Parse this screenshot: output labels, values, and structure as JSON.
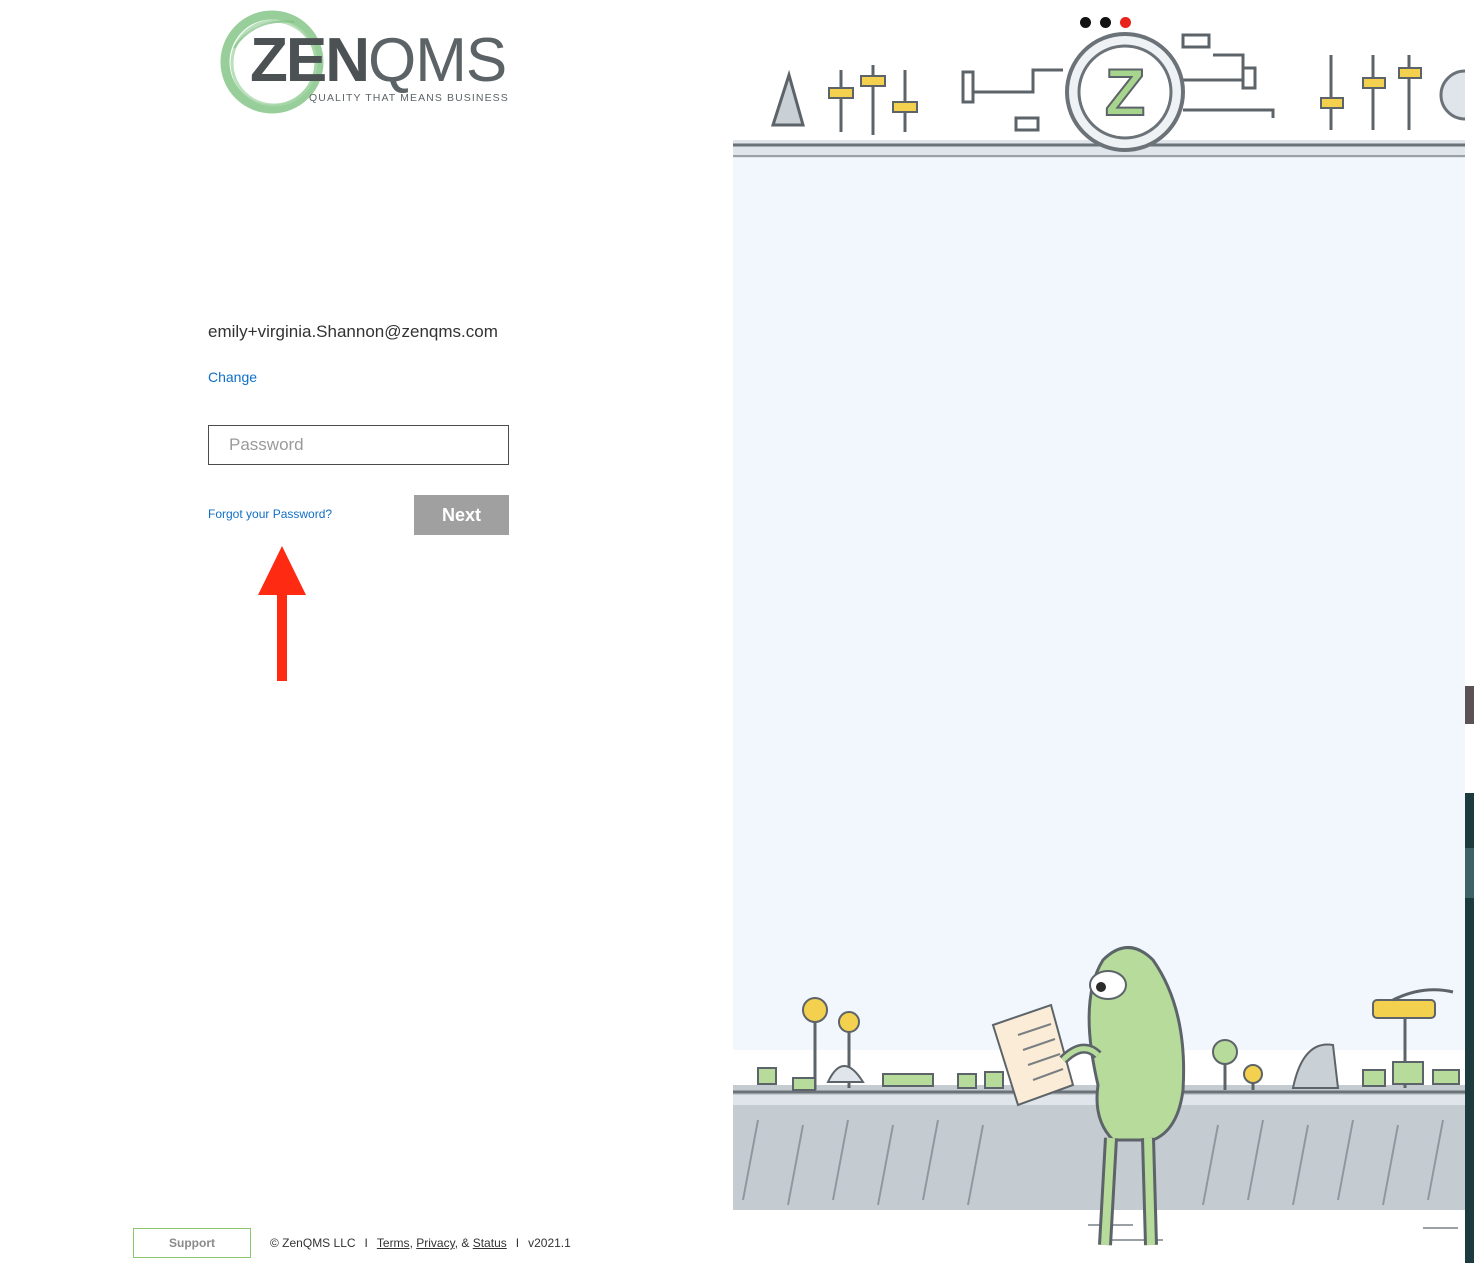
{
  "brand": {
    "logo_word_bold": "ZEN",
    "logo_word_light": "QMS",
    "tagline": "QUALITY THAT MEANS BUSINESS",
    "ring_color": "#8cc98f",
    "text_color": "#4c5254"
  },
  "login": {
    "email": "emily+virginia.Shannon@zenqms.com",
    "change_label": "Change",
    "password_placeholder": "Password",
    "forgot_label": "Forgot your Password?",
    "next_label": "Next",
    "link_color": "#0f6fc7",
    "next_bg": "#a0a0a0"
  },
  "annotation": {
    "arrow_color": "#ff2a12",
    "arrow_icon": "up-arrow-icon"
  },
  "footer": {
    "support_label": "Support",
    "copyright": "© ZenQMS LLC",
    "divider": "I",
    "terms_label": "Terms",
    "privacy_label": "Privacy",
    "and_text": "&",
    "status_label": "Status",
    "version": "v2021.1"
  },
  "carousel": {
    "dots": [
      "inactive",
      "inactive",
      "active"
    ],
    "active_color": "#e8231b",
    "inactive_color": "#111111"
  },
  "illustration": {
    "emblem_letter": "Z",
    "sky_color": "#f1f7fd",
    "character_color": "#b6db9b",
    "floor_color": "#c5ccd1"
  }
}
